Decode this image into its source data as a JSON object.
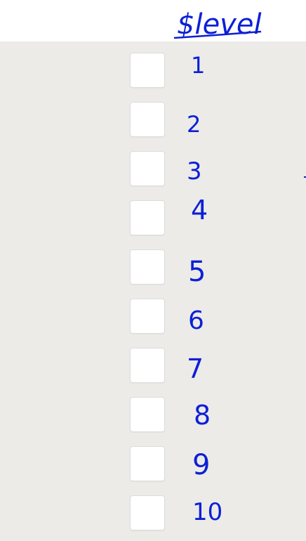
{
  "header": {
    "title": "$level"
  },
  "ink_color": "#0d1fd6",
  "panel_color": "#ecebe8",
  "levels": [
    {
      "label": "1"
    },
    {
      "label": "2"
    },
    {
      "label": "3"
    },
    {
      "label": "4"
    },
    {
      "label": "5"
    },
    {
      "label": "6"
    },
    {
      "label": "7"
    },
    {
      "label": "8"
    },
    {
      "label": "9"
    },
    {
      "label": "10"
    }
  ]
}
